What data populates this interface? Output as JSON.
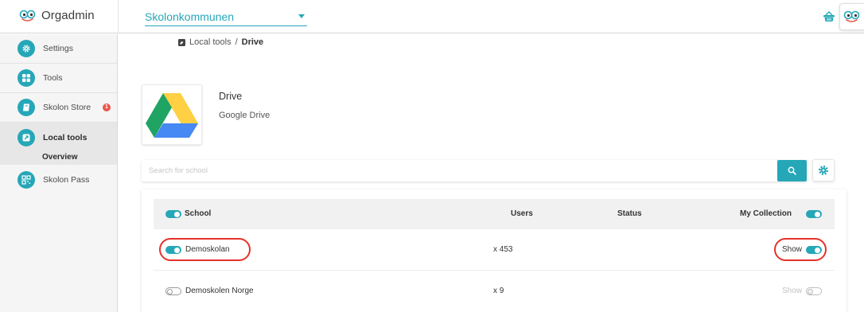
{
  "app": {
    "title": "Orgadmin"
  },
  "header": {
    "organization": "Skolonkommunen"
  },
  "sidebar": {
    "items": [
      {
        "label": "Settings"
      },
      {
        "label": "Tools"
      },
      {
        "label": "Skolon Store",
        "badge": "1"
      },
      {
        "label": "Local tools",
        "active": true,
        "sub": "Overview"
      },
      {
        "label": "Skolon Pass"
      }
    ]
  },
  "breadcrumb": {
    "parent": "Local tools",
    "separator": "/",
    "current": "Drive"
  },
  "tool": {
    "name": "Drive",
    "subtitle": "Google Drive"
  },
  "search": {
    "placeholder": "Search for school",
    "value": ""
  },
  "table": {
    "headers": {
      "school": "School",
      "users": "Users",
      "status": "Status",
      "collection": "My Collection"
    },
    "rows": [
      {
        "school": "Demoskolan",
        "users": "x 453",
        "status": "",
        "collection_label": "Show",
        "school_toggle": true,
        "show_toggle": true
      },
      {
        "school": "Demoskolen Norge",
        "users": "x 9",
        "status": "",
        "collection_label": "Show",
        "school_toggle": false,
        "show_toggle": false
      }
    ]
  },
  "colors": {
    "accent": "#26a7b8",
    "highlight": "#e5312a",
    "badge": "#e8574a"
  }
}
